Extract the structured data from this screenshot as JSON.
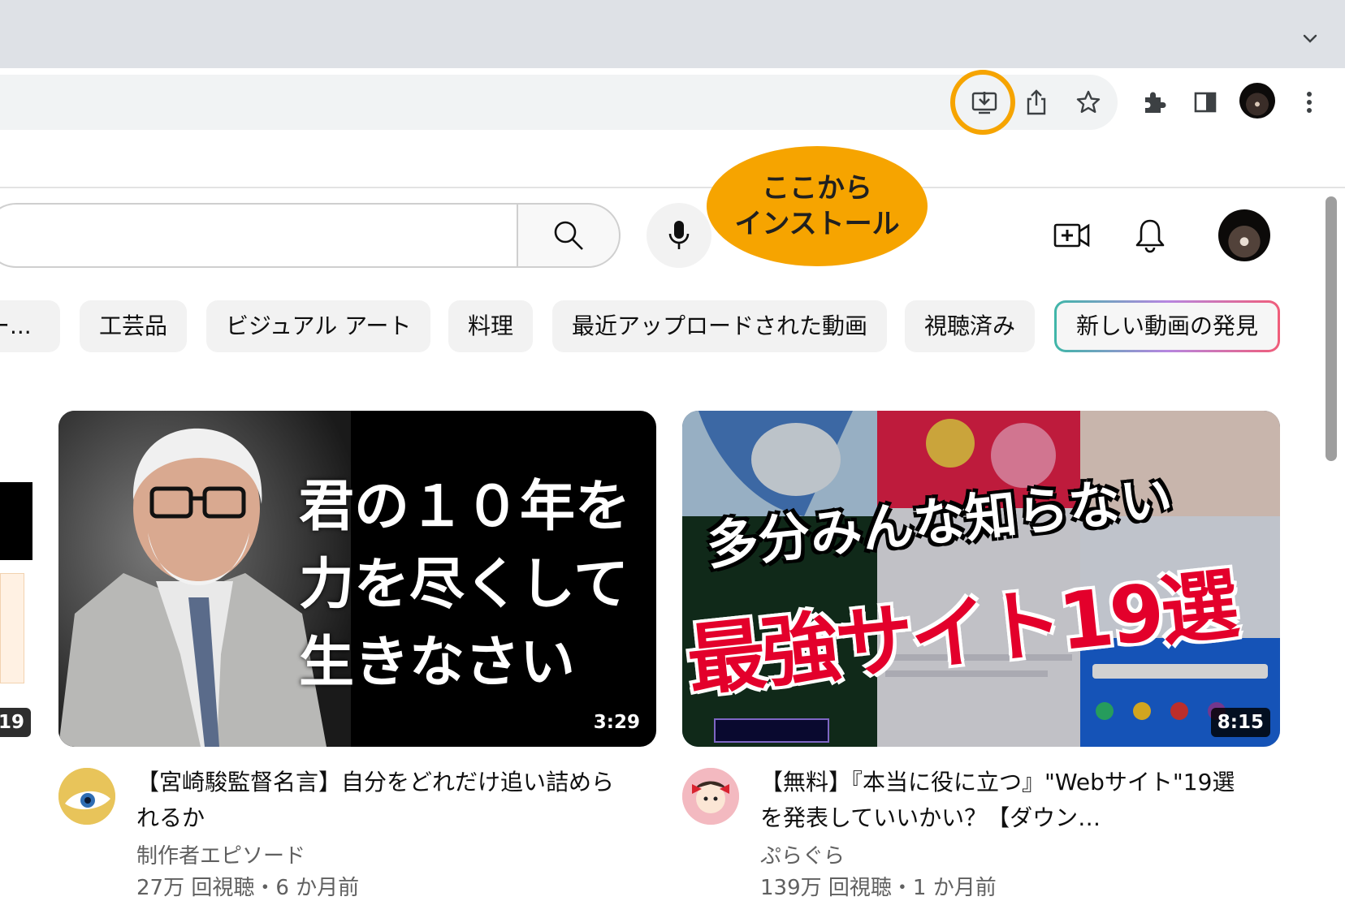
{
  "browser": {
    "tab_menu_icon": "chevron-down-icon",
    "toolbar_icons": [
      "install-app-icon",
      "share-icon",
      "bookmark-star-icon",
      "extensions-puzzle-icon",
      "side-panel-icon",
      "profile-avatar",
      "more-vert-icon"
    ],
    "highlight_color": "#f6a400"
  },
  "callout": {
    "text": "ここから\nインストール"
  },
  "youtube_header": {
    "search_icon": "search-icon",
    "mic_icon": "microphone-icon",
    "create_icon": "create-video-icon",
    "notifications_icon": "bell-icon"
  },
  "chips": [
    {
      "label": "ー..."
    },
    {
      "label": "工芸品"
    },
    {
      "label": "ビジュアル アート"
    },
    {
      "label": "料理"
    },
    {
      "label": "最近アップロードされた動画"
    },
    {
      "label": "視聴済み"
    },
    {
      "label": "新しい動画の発見"
    }
  ],
  "partial_video": {
    "duration_fragment": "19"
  },
  "videos": [
    {
      "thumbnail_text": "君の１０年を\n力を尽くして\n生きなさい",
      "duration": "3:29",
      "title": "【宮崎駿監督名言】自分をどれだけ追い詰められるか",
      "channel": "制作者エピソード",
      "meta": "27万 回視聴・6 か月前"
    },
    {
      "thumbnail_text_top": "多分みんな知らない",
      "thumbnail_text_main": "最強サイト19選",
      "duration": "8:15",
      "title": "【無料】『本当に役に立つ』\"Webサイト\"19選を発表していいかい？【ダウン…",
      "channel": "ぷらぐら",
      "meta": "139万 回視聴・1 か月前"
    }
  ]
}
